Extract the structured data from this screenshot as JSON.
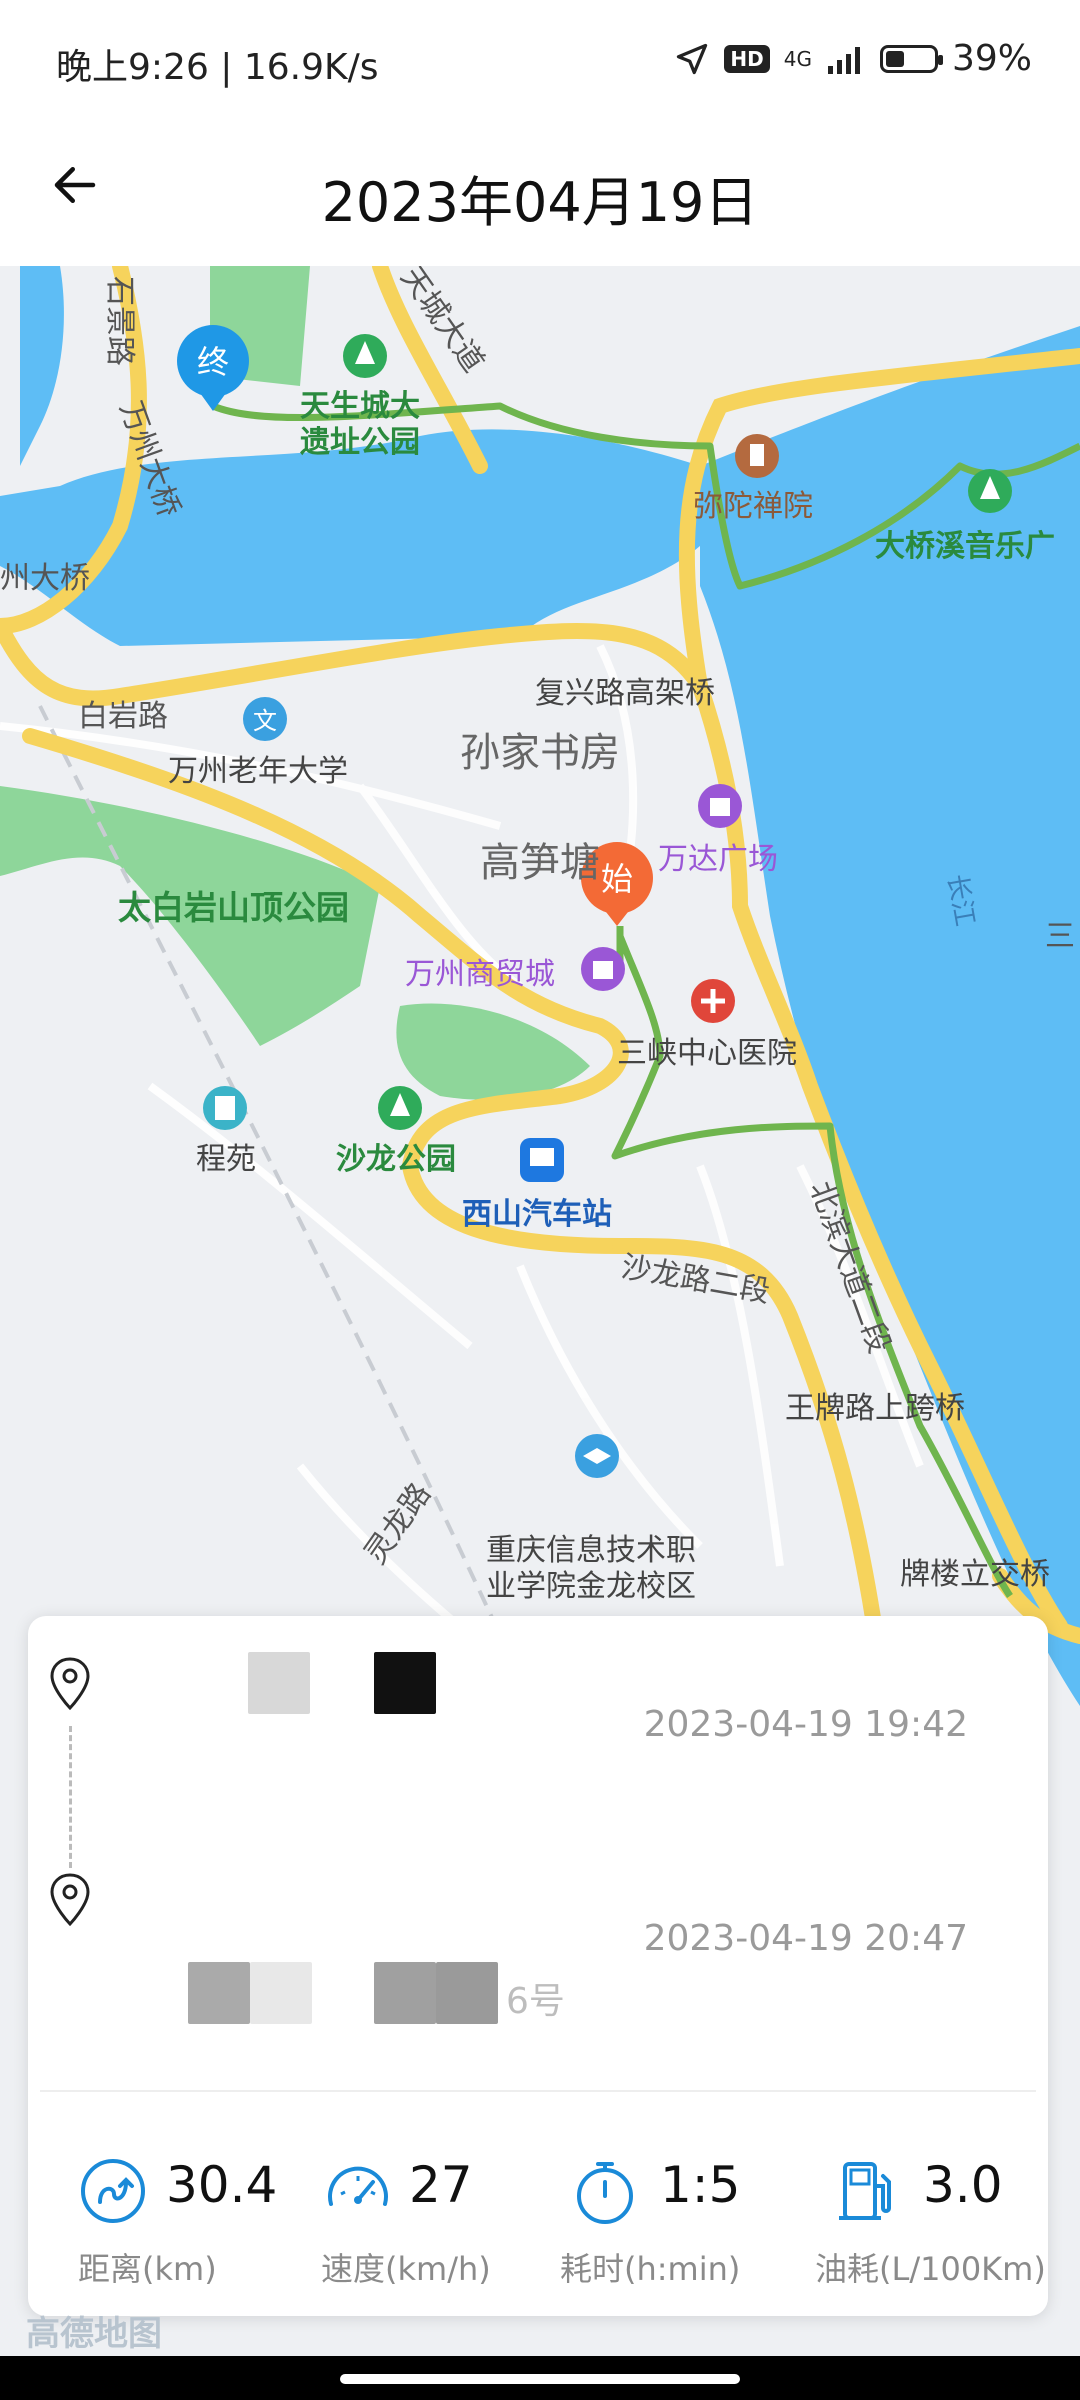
{
  "status_bar": {
    "time_speed": "晚上9:26 | 16.9K/s",
    "hd": "HD",
    "network": "4G",
    "battery": "39%",
    "battery_level": 0.39
  },
  "header": {
    "title": "2023年04月19日"
  },
  "map": {
    "start_marker": "始",
    "end_marker": "终",
    "labels": {
      "tianshengcheng": "天生城大",
      "tianshengcheng2": "遗址公园",
      "mituo": "弥陀禅院",
      "daqiaoxi": "大桥溪音乐广",
      "wanzhou_bridge": "州大桥",
      "fuxing": "复兴路高架桥",
      "sunjia": "孙家书房",
      "baiyan": "白岩路",
      "laonian": "万州老年大学",
      "gaosun": "高笋塘",
      "wanda": "万达广场",
      "taibai": "太白岩山顶公园",
      "shangmao": "万州商贸城",
      "sanxia": "三峡中心医院",
      "chengyuan": "程苑",
      "shalong_park": "沙龙公园",
      "xishan": "西山汽车站",
      "shalong_road": "沙龙路二段",
      "beibin": "北滨大道二段",
      "wangpai": "王牌路上跨桥",
      "linglong": "灵龙路",
      "chongqing1": "重庆信息技术职",
      "chongqing2": "业学院金龙校区",
      "pailou": "牌楼立交桥",
      "changjiang": "长江",
      "tiancheng": "天城大道",
      "wanzhou_daqiao": "万州大桥",
      "shijing": "石景路",
      "san": "三"
    },
    "logo": "高德地图"
  },
  "trip": {
    "start_time": "2023-04-19 19:42",
    "end_time": "2023-04-19 20:47",
    "end_address_suffix": "6号"
  },
  "stats": [
    {
      "icon": "distance-icon",
      "value": "30.4",
      "label": "距离(km)"
    },
    {
      "icon": "speed-icon",
      "value": "27",
      "label": "速度(km/h)"
    },
    {
      "icon": "timer-icon",
      "value": "1:5",
      "label": "耗时(h:min)"
    },
    {
      "icon": "fuel-icon",
      "value": "3.0",
      "label": "油耗(L/100Km)"
    }
  ]
}
